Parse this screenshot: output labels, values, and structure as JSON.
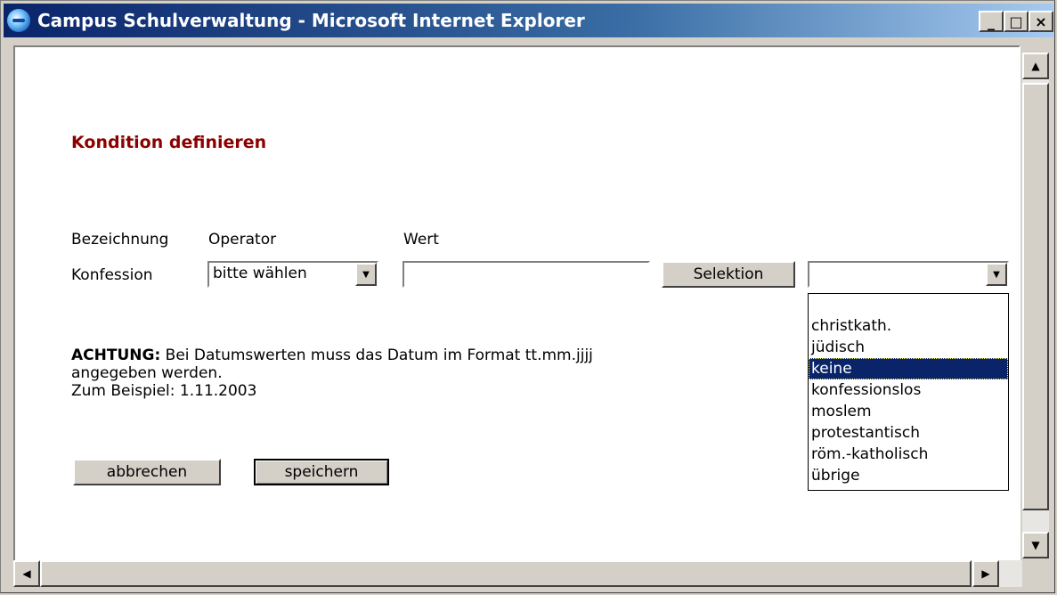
{
  "window": {
    "title": "Campus Schulverwaltung - Microsoft Internet Explorer",
    "minimize": "_",
    "maximize": "□",
    "close": "×"
  },
  "page": {
    "heading": "Kondition definieren",
    "headers": {
      "bezeichnung": "Bezeichnung",
      "operator": "Operator",
      "wert": "Wert"
    },
    "row": {
      "label": "Konfession",
      "operator_selected": "bitte wählen",
      "wert_value": "",
      "selektion_button": "Selektion",
      "value_select_selected": ""
    },
    "dropdown_options": [
      "",
      "christkath.",
      "jüdisch",
      "keine",
      "konfessionslos",
      "moslem",
      "protestantisch",
      "röm.-katholisch",
      "übrige"
    ],
    "dropdown_highlighted": "keine",
    "warning": {
      "prefix": "ACHTUNG:",
      "line1": " Bei Datumswerten muss das Datum im Format tt.mm.jjjj",
      "line2": "angegeben werden.",
      "line3": "Zum Beispiel: 1.11.2003"
    },
    "buttons": {
      "cancel": "abbrechen",
      "save": "speichern"
    }
  },
  "colors": {
    "heading": "#8b0000",
    "selection": "#0a246a",
    "titlebar_start": "#0a246a",
    "titlebar_end": "#a6caf0"
  },
  "icons": {
    "app": "internet-explorer-icon",
    "scroll_up": "arrow-up-icon",
    "scroll_down": "arrow-down-icon",
    "scroll_left": "arrow-left-icon",
    "scroll_right": "arrow-right-icon",
    "dropdown": "chevron-down-icon"
  }
}
